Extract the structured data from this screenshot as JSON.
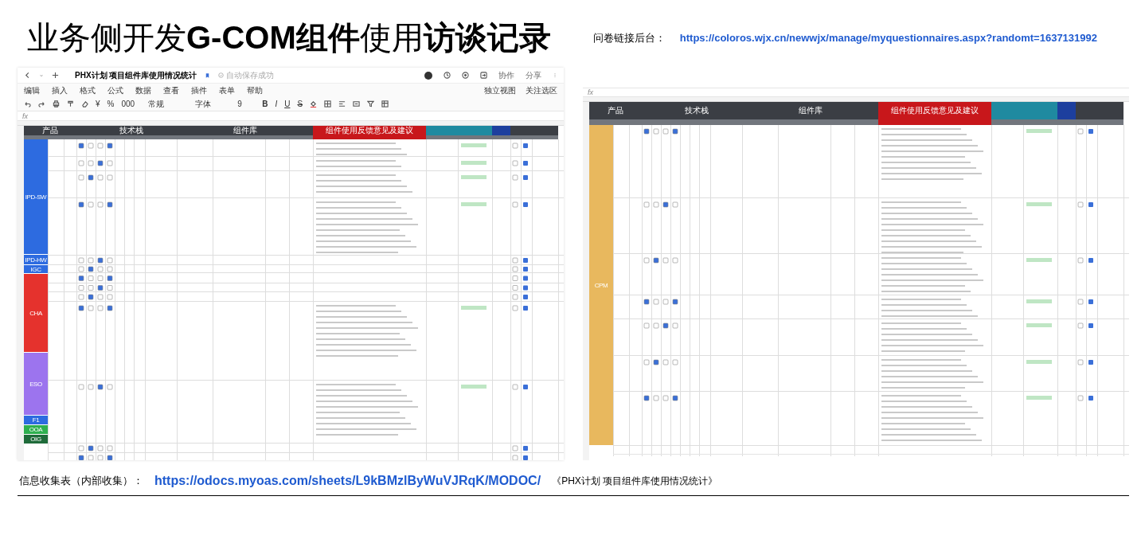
{
  "title": "业务侧开发**G-COM组件**使用**访谈记录**",
  "survey_link": {
    "label": "问卷链接后台：",
    "url": "https://coloros.wjx.cn/newwjx/manage/myquestionnaires.aspx?randomt=1637131992"
  },
  "sheets": [
    {
      "kind": "full",
      "doc_title": "PHX计划 项目组件库使用情况统计",
      "save_status": "自动保存成功",
      "actions": [
        "协作",
        "分享"
      ],
      "menu": [
        "编辑",
        "插入",
        "格式",
        "公式",
        "数据",
        "查看",
        "插件",
        "表单",
        "帮助"
      ],
      "view_menu": [
        "独立视图",
        "关注选区"
      ],
      "format": {
        "currency": "¥",
        "percent": "%",
        "thousands": "000",
        "number_format": "常规",
        "font": "字体",
        "size": "9",
        "text_buttons": [
          "B",
          "I",
          "U",
          "S"
        ]
      },
      "formula_label": "fx",
      "header_groups": [
        {
          "label": "产品",
          "color": "#3b3e44"
        },
        {
          "color": "#3b3e44"
        },
        {
          "label": "技术栈",
          "color": "#3b3e44"
        },
        {
          "label": "组件库",
          "color": "#3b3e44"
        },
        {
          "label": "组件使用反馈意见及建议",
          "color": "#c8171b"
        },
        {
          "color": "#1f8aa0"
        },
        {
          "color": "#1f8aa0"
        },
        {
          "color": "#1d3f9e"
        },
        {
          "color": "#3b3e44"
        },
        {
          "color": "#3b3e44"
        }
      ],
      "domains": [
        {
          "label": "IPD-SW",
          "color": "#2d6be0"
        },
        {
          "label": "IPD-HW",
          "color": "#2d6be0"
        },
        {
          "label": "IGC",
          "color": "#2d6be0"
        },
        {
          "label": "CHA",
          "color": "#e5322d"
        },
        {
          "label": "ESO",
          "color": "#9c74ee"
        },
        {
          "label": "F1",
          "color": "#2d6be0"
        },
        {
          "label": "OOA",
          "color": "#2eb04f"
        },
        {
          "label": "OIG",
          "color": "#1f6b3a"
        }
      ]
    },
    {
      "kind": "grid_only",
      "formula_label": "fx",
      "header_groups": [
        {
          "label": "产品",
          "color": "#3b3e44"
        },
        {
          "color": "#3b3e44"
        },
        {
          "label": "技术栈",
          "color": "#3b3e44"
        },
        {
          "label": "组件库",
          "color": "#3b3e44"
        },
        {
          "label": "组件使用反馈意见及建议",
          "color": "#c8171b"
        },
        {
          "color": "#1f8aa0"
        },
        {
          "color": "#1f8aa0"
        },
        {
          "color": "#1d3f9e"
        },
        {
          "color": "#3b3e44"
        },
        {
          "color": "#3b3e44"
        }
      ],
      "domains": [
        {
          "label": "CPM",
          "color": "#e8b85e"
        }
      ]
    }
  ],
  "footer": {
    "label": "信息收集表（内部收集）：",
    "url": "https://odocs.myoas.com/sheets/L9kBMzlByWuVJRqK/MODOC/",
    "doc_name": "《PHX计划 项目组件库使用情况统计》"
  }
}
